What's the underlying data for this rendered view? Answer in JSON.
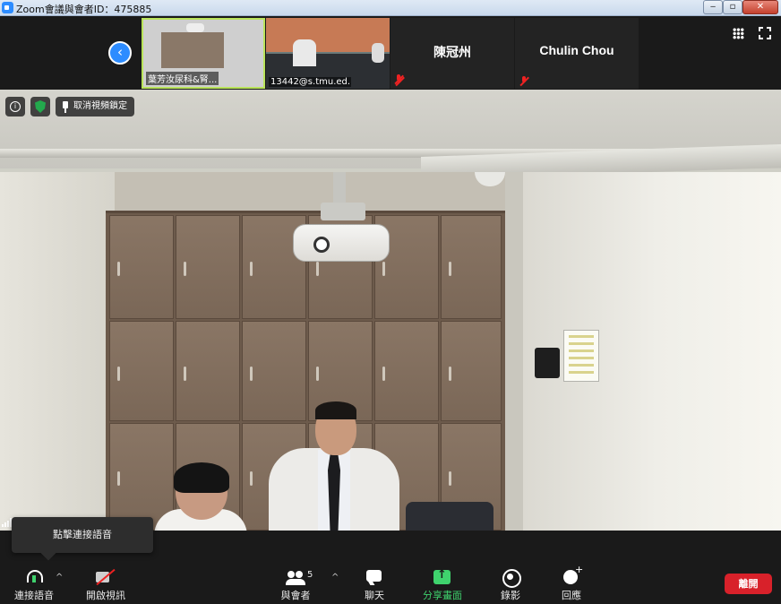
{
  "window": {
    "title": "Zoom會議與會者ID：475885",
    "minimize_glyph": "‒",
    "maximize_glyph": "▫",
    "close_glyph": "✕"
  },
  "gallery": {
    "participants": [
      {
        "caption": "葉芳汝尿科&腎..."
      },
      {
        "caption": "13442@s.tmu.ed..."
      },
      {
        "name": "陳冠州"
      },
      {
        "name": "Chulin Chou"
      }
    ]
  },
  "video": {
    "unpin_label": "取消視頻鎖定"
  },
  "tooltip": {
    "text": "點擊連接語音"
  },
  "toolbar": {
    "audio_label": "連接語音",
    "video_label": "開啟視訊",
    "participants_label": "與會者",
    "participants_count": "5",
    "chat_label": "聊天",
    "share_label": "分享畫面",
    "record_label": "錄影",
    "reactions_label": "回應",
    "leave_label": "離開"
  }
}
